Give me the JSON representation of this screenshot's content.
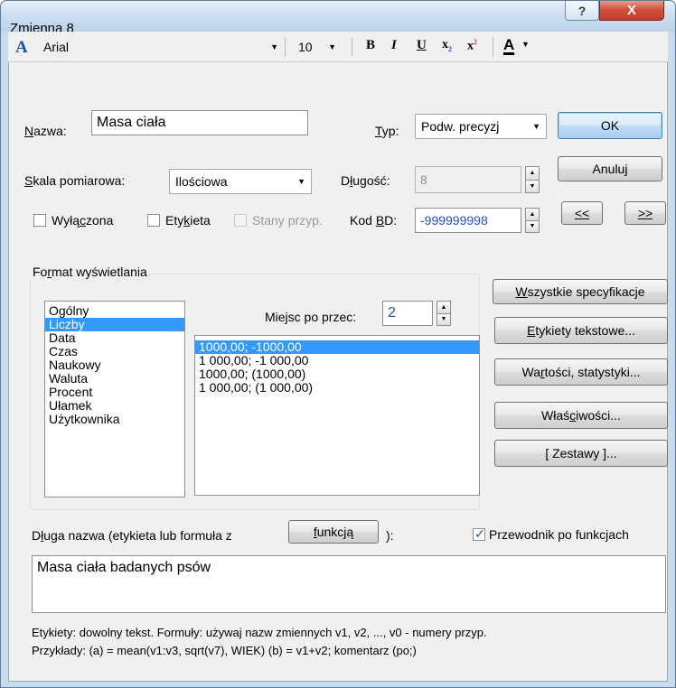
{
  "window": {
    "title": "Zmienna 8",
    "help_glyph": "?",
    "close_glyph": "X"
  },
  "toolbar": {
    "font_icon": "A",
    "font_name": "Arial",
    "font_size": "10",
    "bold": "B",
    "italic": "I",
    "underline": "U",
    "subscript": "x",
    "subscript_mark": "2",
    "superscript": "x",
    "superscript_mark": "2",
    "text_color_icon": "A"
  },
  "form": {
    "name_label_u": "N",
    "name_label_rest": "azwa:",
    "name_value": "Masa ciała",
    "type_label_u": "T",
    "type_label_rest": "yp:",
    "type_value": "Podw. precyzj",
    "scale_label_u": "S",
    "scale_label_rest": "kala pomiarowa:",
    "scale_value": "Ilościowa",
    "length_label_pre": "D",
    "length_label_u": "ł",
    "length_label_rest": "ugość:",
    "length_value": "8",
    "excluded_label_pre": "Wyłą",
    "excluded_label_u": "c",
    "excluded_label_rest": "zona",
    "label_cb_pre": "Ety",
    "label_cb_u": "k",
    "label_cb_rest": "ieta",
    "states_label": "Stany przyp.",
    "code_label_pre": "Kod ",
    "code_label_u": "B",
    "code_label_rest": "D:",
    "code_value": "-999999998"
  },
  "buttons": {
    "ok": "OK",
    "cancel": "Anuluj",
    "prev": "<<",
    "next": ">>",
    "all_specs_u": "W",
    "all_specs_rest": "szystkie specyfikacje",
    "text_labels_u": "E",
    "text_labels_rest": "tykiety tekstowe...",
    "values_stats_pre": "Wa",
    "values_stats_u": "r",
    "values_stats_rest": "tości, statystyki...",
    "properties_pre": "Właś",
    "properties_u": "c",
    "properties_rest": "iwości...",
    "sets": "[ Zestawy ]...",
    "function_u": "f",
    "function_rest": "unkcją"
  },
  "format": {
    "group_label_pre": "Fo",
    "group_label_u": "r",
    "group_label_rest": "mat wyświetlania",
    "categories": [
      "Ogólny",
      "Liczby",
      "Data",
      "Czas",
      "Naukowy",
      "Waluta",
      "Procent",
      "Ułamek",
      "Użytkownika"
    ],
    "selected_category": "Liczby",
    "decimals_label": "Miejsc po przec:",
    "decimals_value": "2",
    "number_formats": [
      "1000,00; -1000,00",
      "1 000,00; -1 000,00",
      "1000,00; (1000,00)",
      "1 000,00; (1 000,00)"
    ],
    "selected_format": "1000,00; -1000,00"
  },
  "long_name": {
    "label_pre": "D",
    "label_u": "ł",
    "label_mid": "uga nazwa (etykieta lub formuła z",
    "label_end": "):",
    "wizard_label": "Przewodnik po funkcjach",
    "wizard_checked": true,
    "value": "Masa ciała badanych psów"
  },
  "hints": {
    "line1": "Etykiety: dowolny tekst. Formuły: używaj nazw zmiennych v1, v2, ..., v0 - numery przyp.",
    "line2": "Przykłady:   (a) = mean(v1:v3, sqrt(v7), WIEK)  (b) = v1+v2; komentarz (po;)"
  }
}
